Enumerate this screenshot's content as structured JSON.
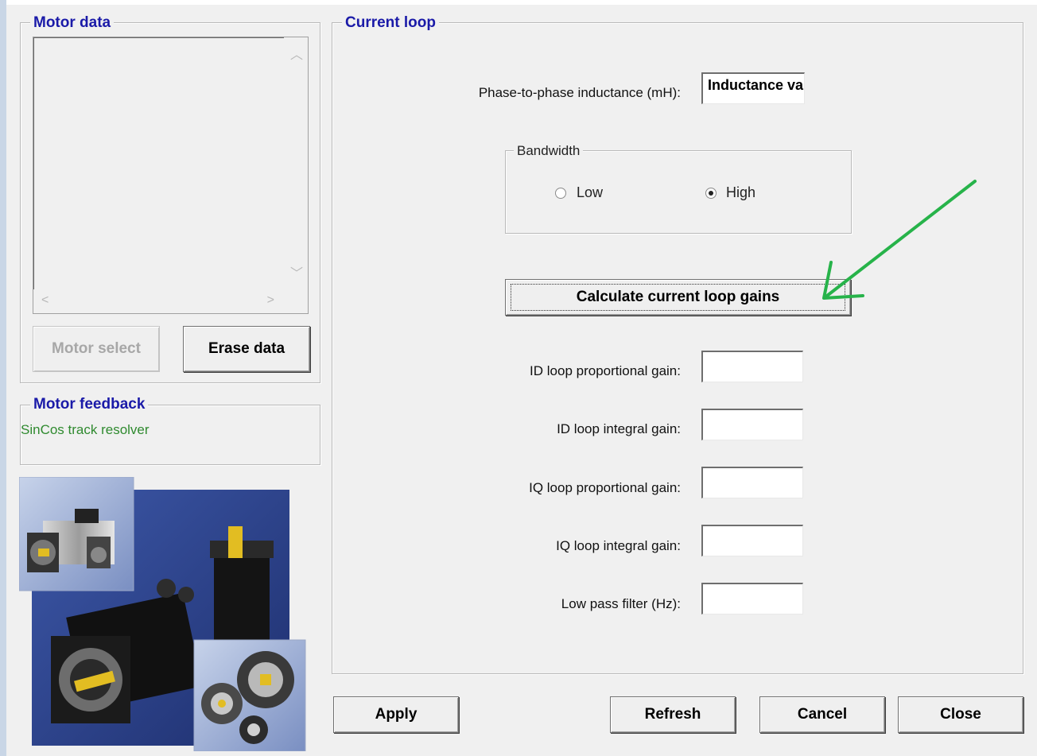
{
  "motor_data": {
    "title": "Motor data",
    "motor_select_label": "Motor select",
    "erase_data_label": "Erase data"
  },
  "motor_feedback": {
    "title": "Motor feedback",
    "value": "SinCos track resolver"
  },
  "current_loop": {
    "title": "Current loop",
    "inductance_label": "Phase-to-phase inductance (mH):",
    "inductance_value": "Inductance value",
    "bandwidth": {
      "title": "Bandwidth",
      "low_label": "Low",
      "high_label": "High",
      "selected": "High"
    },
    "calculate_label": "Calculate current loop gains",
    "fields": [
      {
        "label": "ID loop proportional gain:",
        "value": ""
      },
      {
        "label": "ID loop integral gain:",
        "value": ""
      },
      {
        "label": "IQ loop proportional gain:",
        "value": ""
      },
      {
        "label": "IQ loop integral gain:",
        "value": ""
      },
      {
        "label": "Low pass filter (Hz):",
        "value": ""
      }
    ]
  },
  "footer": {
    "apply_label": "Apply",
    "refresh_label": "Refresh",
    "cancel_label": "Cancel",
    "close_label": "Close"
  },
  "colors": {
    "legend_blue": "#1a1aa8",
    "feedback_green": "#2f8a2f",
    "annotation_arrow": "#27b34a"
  }
}
